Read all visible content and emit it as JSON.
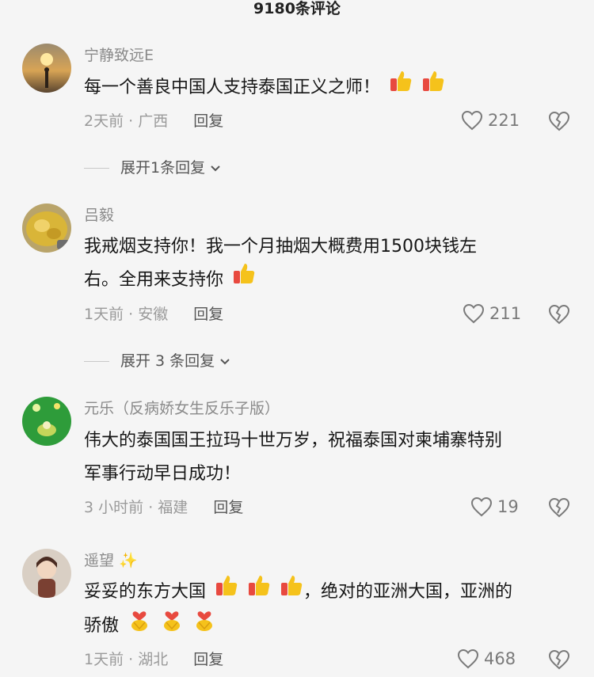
{
  "header": {
    "title": "9180条评论"
  },
  "comments": [
    {
      "username": "宁静致远E",
      "text": "每一个善良中国人支持泰国正义之师！",
      "time": "2天前",
      "location": "广西",
      "reply_label": "回复",
      "likes": "221",
      "expand_label": "展开1条回复",
      "emojis": [
        "thumbs-up-icon",
        "thumbs-up-icon"
      ]
    },
    {
      "username": "吕毅",
      "text_line1": "我戒烟支持你！我一个月抽烟大概费用1500块钱左",
      "text_line2": "右。全用来支持你",
      "time": "1天前",
      "location": "安徽",
      "reply_label": "回复",
      "likes": "211",
      "expand_label": "展开 3 条回复",
      "emojis": [
        "thumbs-up-icon"
      ]
    },
    {
      "username": "元乐（反病娇女生反乐子版）",
      "text_line1": "伟大的泰国国王拉玛十世万岁，祝福泰国对柬埔寨特别",
      "text_line2": "军事行动早日成功！",
      "time": "3 小时前",
      "location": "福建",
      "reply_label": "回复",
      "likes": "19"
    },
    {
      "username": "遥望",
      "text_line1": "妥妥的东方大国",
      "text_line1b": "，绝对的亚洲大国，亚洲的",
      "text_line2": "骄傲",
      "time": "1天前",
      "location": "湖北",
      "reply_label": "回复",
      "likes": "468",
      "emojis": [
        "thumbs-up-icon",
        "thumbs-up-icon",
        "thumbs-up-icon",
        "heart-hands-icon",
        "heart-hands-icon",
        "heart-hands-icon"
      ]
    }
  ],
  "meta_separator": "·",
  "colors": {
    "background": "#f5f5f5",
    "emoji_yellow": "#f5c21b",
    "emoji_red": "#e8493f"
  }
}
